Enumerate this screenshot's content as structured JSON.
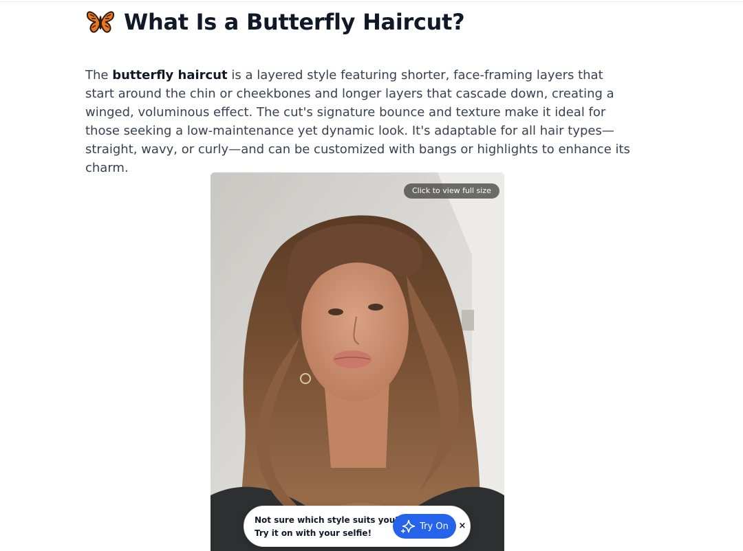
{
  "article": {
    "heading_icon": "butterfly-icon",
    "heading": "What Is a Butterfly Haircut?",
    "paragraph": {
      "lead": "The ",
      "bold": "butterfly haircut",
      "rest": " is a layered style featuring shorter, face-framing layers that start around the chin or cheekbones and longer layers that cascade down, creating a winged, voluminous effect. The cut's signature bounce and texture make it ideal for those seeking a low-maintenance yet dynamic look. It's adaptable for all hair types—straight, wavy, or curly—and can be customized with bangs or highlights to enhance its charm."
    }
  },
  "image": {
    "view_full_label": "Click to view full size",
    "subject": "woman with brown butterfly haircut"
  },
  "tryon_banner": {
    "line1": "Not sure which style suits you?",
    "line2": "Try it on with your selfie!",
    "button_label": "Try On",
    "button_icon": "sparkle-icon",
    "close_label": "×"
  },
  "colors": {
    "accent": "#2563eb",
    "butterfly_orange": "#e8761f"
  }
}
